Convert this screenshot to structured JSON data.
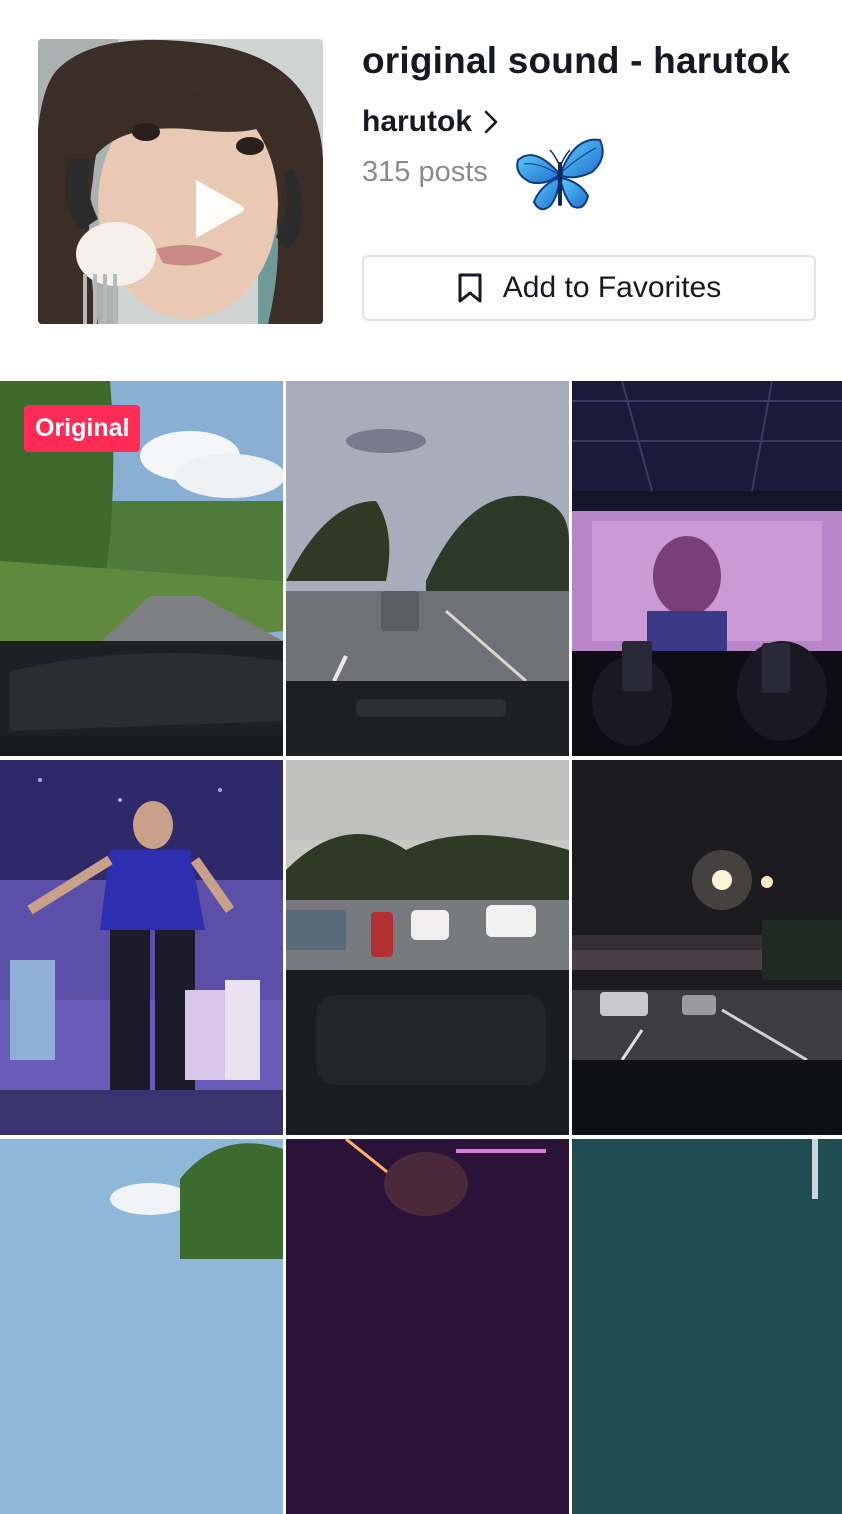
{
  "sound": {
    "title": "original sound - harutok",
    "author": "harutok",
    "posts": "315 posts",
    "favorite_label": "Add to Favorites"
  },
  "icons": {
    "play": "play-icon",
    "author_arrow": "chevron-right-icon",
    "decoration": "butterfly-icon",
    "favorite": "bookmark-icon"
  },
  "colors": {
    "badge": "#fe2c55",
    "butterfly": "#2aa1e6",
    "posts_text": "#8a8b91"
  },
  "videos": [
    {
      "scene": "car-dashboard-country-road",
      "badge": "Original"
    },
    {
      "scene": "car-dashboard-town-road-dusk",
      "badge": ""
    },
    {
      "scene": "concert-stage-led-screen",
      "badge": ""
    },
    {
      "scene": "concert-performer-blue-shirt",
      "badge": ""
    },
    {
      "scene": "car-dashboard-busy-street",
      "badge": ""
    },
    {
      "scene": "car-dashboard-night-road",
      "badge": ""
    },
    {
      "scene": "trees-sky",
      "badge": ""
    },
    {
      "scene": "concert-purple-lights",
      "badge": ""
    },
    {
      "scene": "dark-teal",
      "badge": ""
    }
  ]
}
